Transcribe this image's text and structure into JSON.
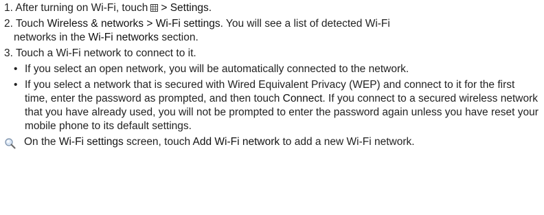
{
  "step1": {
    "number": "1.",
    "text_before": "After turning on Wi-Fi, touch",
    "icon": "grid-menu-icon",
    "text_after": "> Settings."
  },
  "step2": {
    "number": "2.",
    "text_a": "Touch",
    "path": "Wireless & networks > Wi-Fi settings",
    "text_b": ". You will see a list of detected Wi-Fi",
    "text_c": "networks in the",
    "section_name": "Wi-Fi networks",
    "text_d": "section."
  },
  "step3": {
    "number": "3.",
    "text": "Touch a Wi-Fi network to connect to it."
  },
  "bullets": [
    {
      "marker": "•",
      "text": "If you select an open network, you will be automatically connected to the network."
    },
    {
      "marker": "•",
      "text_a": "If you select a network that is secured with Wired Equivalent Privacy (WEP) and connect to it for the first time, enter the password as prompted, and then touch",
      "button": "Connect",
      "text_b": ". If you connect to a secured wireless network that you have already used, you will not be prompted to enter the password again unless you have reset your mobile phone to its default settings."
    }
  ],
  "tip": {
    "icon": "tip-magnifier-icon",
    "text_a": "On the",
    "screen": "Wi-Fi settings",
    "text_b": "screen, touch",
    "action": "Add Wi-Fi network",
    "text_c": "to add a new Wi-Fi network."
  },
  "colors": {
    "text": "#222222",
    "icon_blue": "#3a7fd0"
  }
}
